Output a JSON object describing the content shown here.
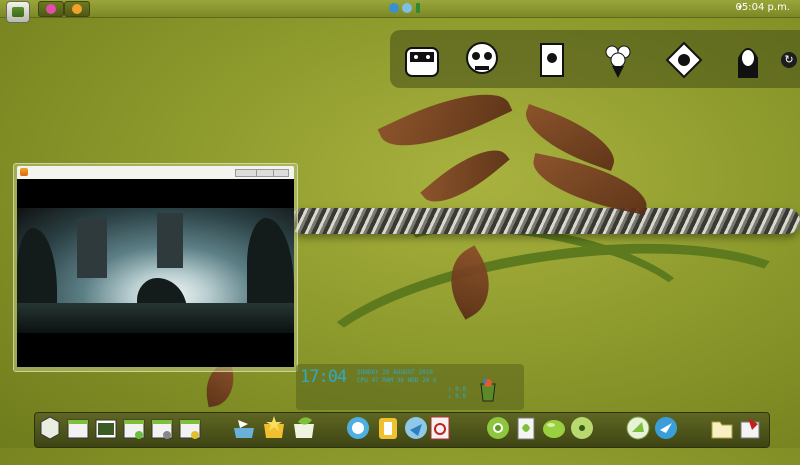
{
  "taskbar": {
    "clock": "05:04 p.m.",
    "dropdown_glyph": "▾",
    "tasks": [
      {
        "name": "theme-app",
        "icon": "pink-gear-icon",
        "color": "#e04fa8"
      },
      {
        "name": "media-player",
        "icon": "play-icon",
        "color": "#f2a12a"
      }
    ],
    "tray": [
      "globe-icon",
      "network-icon",
      "battery-icon"
    ]
  },
  "top_dock": {
    "items": [
      "ninja-icon",
      "skull-icon",
      "book-icon",
      "bouquet-icon",
      "cat-icon",
      "woman-icon"
    ],
    "refresh_glyph": "↻"
  },
  "media_player": {
    "controls": [
      "minimize",
      "maximize",
      "close"
    ]
  },
  "system_monitor": {
    "time": "17:04",
    "date": "SUNDAY 29 AUGUST 2010",
    "stats": "CPU  47    RAM  36    HDD  24 G",
    "net_line1": "↑ 0.0",
    "net_line2": "↓ 0.0"
  },
  "bottom_dock": {
    "groups": [
      [
        "cube-icon",
        "windows-icon",
        "photo-icon",
        "download-window-icon",
        "settings-window-icon",
        "upload-window-icon"
      ],
      [
        "bird-folder-icon",
        "star-folder-icon",
        "green-leaf-folder-icon"
      ],
      [
        "photoshop-icon",
        "illustrator-icon",
        "blue-folder-icon",
        "pdf-reader-icon"
      ],
      [
        "chrome-icon",
        "notes-icon",
        "lime-ball-icon",
        "disc-icon"
      ],
      [
        "globe-app-icon",
        "bird-app-icon"
      ],
      [
        "folder-icon",
        "books-icon"
      ]
    ]
  },
  "colors": {
    "wallpaper": "#8d9a2c",
    "accent_cyan": "#2fa9c4",
    "dock": "#4a5218"
  }
}
